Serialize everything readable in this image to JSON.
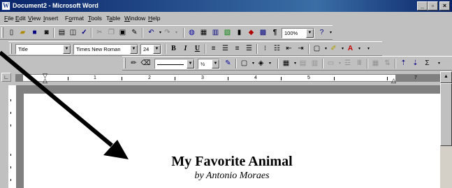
{
  "window": {
    "title": "Document2 - Microsoft Word",
    "app_icon": "W"
  },
  "caption": {
    "min": "_",
    "max": "▫",
    "close": "×"
  },
  "menu": [
    {
      "pre": "",
      "u": "F",
      "post": "ile"
    },
    {
      "pre": "",
      "u": "E",
      "post": "dit"
    },
    {
      "pre": "",
      "u": "V",
      "post": "iew"
    },
    {
      "pre": "",
      "u": "I",
      "post": "nsert"
    },
    {
      "pre": "F",
      "u": "o",
      "post": "rmat"
    },
    {
      "pre": "",
      "u": "T",
      "post": "ools"
    },
    {
      "pre": "T",
      "u": "a",
      "post": "ble"
    },
    {
      "pre": "",
      "u": "W",
      "post": "indow"
    },
    {
      "pre": "",
      "u": "H",
      "post": "elp"
    }
  ],
  "standard_toolbar": {
    "zoom": "100%"
  },
  "formatting_toolbar": {
    "style": "Title",
    "font": "Times New Roman",
    "size": "24",
    "bold": "B",
    "italic": "I",
    "underline": "U"
  },
  "drawing_toolbar": {
    "line_weight": "½"
  },
  "ruler": {
    "numbers": [
      "1",
      "2",
      "3",
      "4",
      "5",
      "7"
    ]
  },
  "document": {
    "title": "My Favorite Animal",
    "byline": "by Antonio Moraes"
  },
  "colors": {
    "titlebar": "#0a246a",
    "face": "#c0c0c0",
    "highlight": "#ffff00",
    "font_color": "#ff0000",
    "arrow": "#000000"
  }
}
